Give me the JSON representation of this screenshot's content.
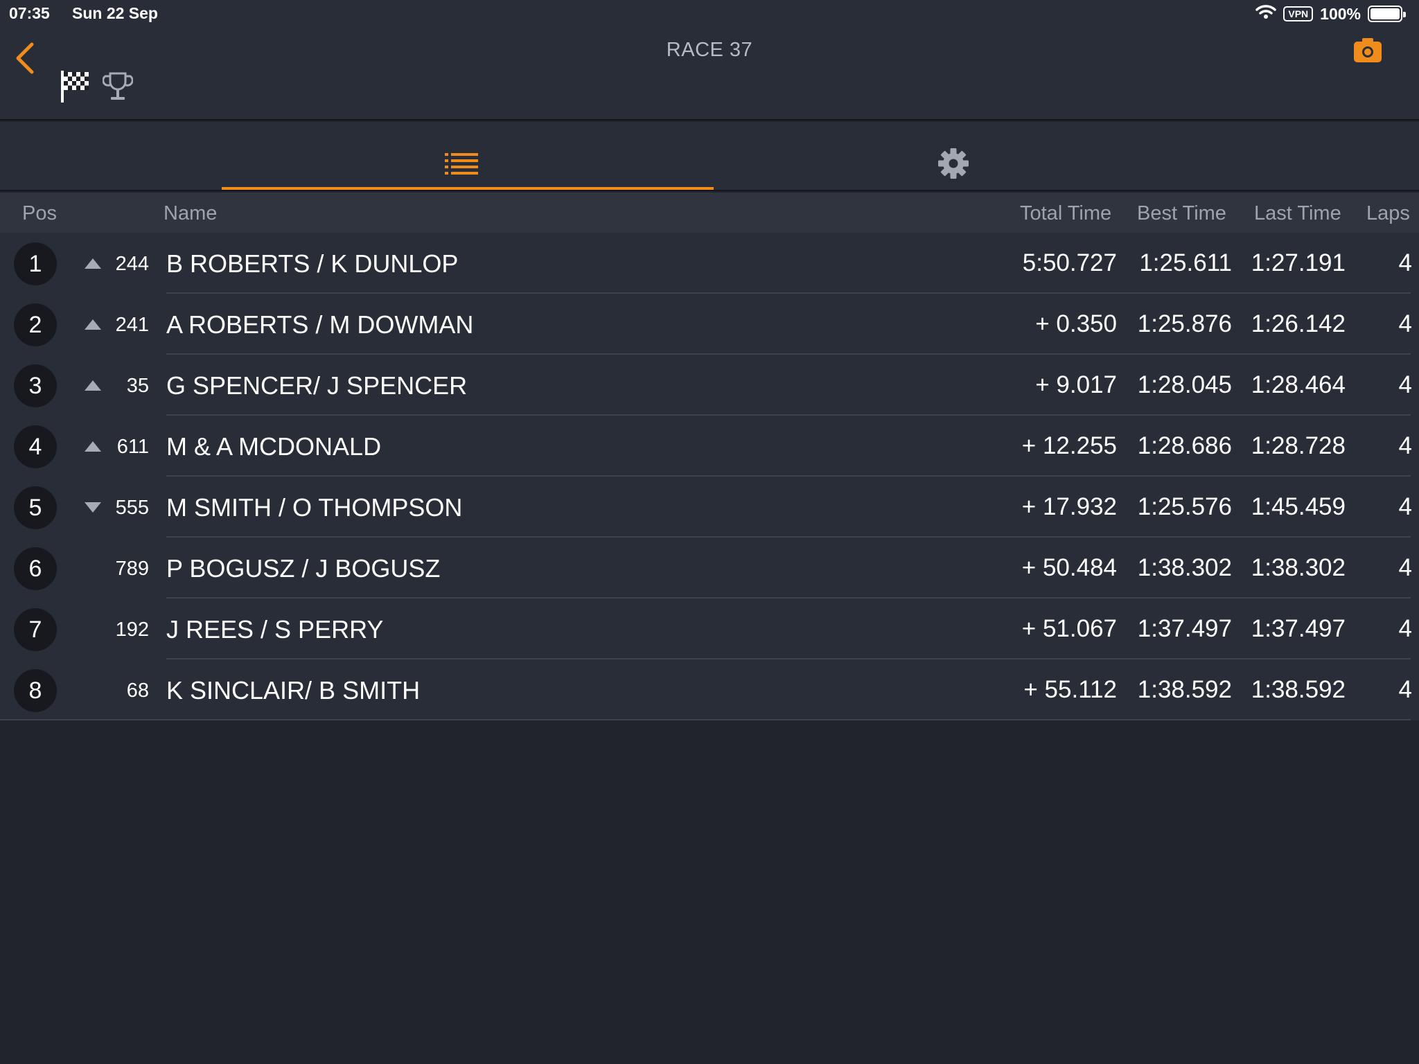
{
  "status_bar": {
    "time": "07:35",
    "date": "Sun 22 Sep",
    "vpn": "VPN",
    "battery": "100%",
    "battery_level": 1.0
  },
  "header": {
    "title": "RACE 37",
    "accent_color": "#f08c1c"
  },
  "tabs": [
    {
      "icon": "list-icon",
      "active": true
    },
    {
      "icon": "gear-icon",
      "active": false
    }
  ],
  "table": {
    "headers": {
      "pos": "Pos",
      "name": "Name",
      "total": "Total Time",
      "best": "Best Time",
      "last": "Last Time",
      "laps": "Laps"
    },
    "rows": [
      {
        "pos": "1",
        "trend": "up",
        "number": "244",
        "name": "B ROBERTS / K DUNLOP",
        "total": "5:50.727",
        "best": "1:25.611",
        "last": "1:27.191",
        "laps": "4"
      },
      {
        "pos": "2",
        "trend": "up",
        "number": "241",
        "name": "A ROBERTS / M DOWMAN",
        "total": "+ 0.350",
        "best": "1:25.876",
        "last": "1:26.142",
        "laps": "4"
      },
      {
        "pos": "3",
        "trend": "up",
        "number": "35",
        "name": "G SPENCER/ J SPENCER",
        "total": "+ 9.017",
        "best": "1:28.045",
        "last": "1:28.464",
        "laps": "4"
      },
      {
        "pos": "4",
        "trend": "up",
        "number": "611",
        "name": "M & A MCDONALD",
        "total": "+ 12.255",
        "best": "1:28.686",
        "last": "1:28.728",
        "laps": "4"
      },
      {
        "pos": "5",
        "trend": "down",
        "number": "555",
        "name": "M SMITH / O THOMPSON",
        "total": "+ 17.932",
        "best": "1:25.576",
        "last": "1:45.459",
        "laps": "4"
      },
      {
        "pos": "6",
        "trend": "none",
        "number": "789",
        "name": "P BOGUSZ / J BOGUSZ",
        "total": "+ 50.484",
        "best": "1:38.302",
        "last": "1:38.302",
        "laps": "4"
      },
      {
        "pos": "7",
        "trend": "none",
        "number": "192",
        "name": "J REES / S PERRY",
        "total": "+ 51.067",
        "best": "1:37.497",
        "last": "1:37.497",
        "laps": "4"
      },
      {
        "pos": "8",
        "trend": "none",
        "number": "68",
        "name": "K SINCLAIR/ B SMITH",
        "total": "+ 55.112",
        "best": "1:38.592",
        "last": "1:38.592",
        "laps": "4"
      }
    ]
  }
}
